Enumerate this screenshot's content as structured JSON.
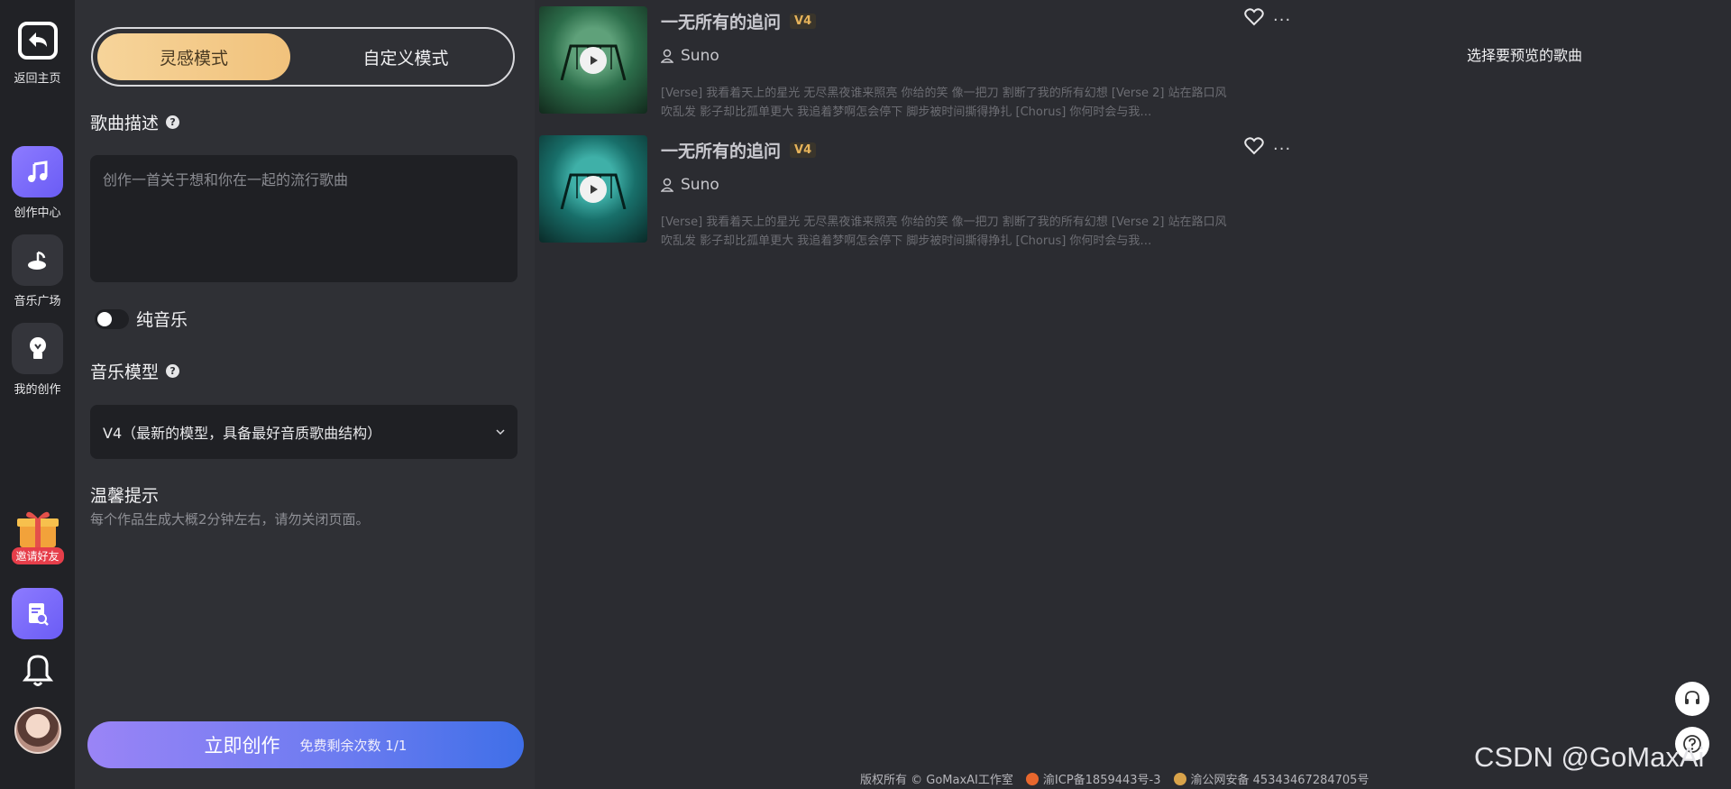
{
  "rail": {
    "back_label": "返回主页",
    "create_label": "创作中心",
    "square_label": "音乐广场",
    "mine_label": "我的创作",
    "invite_label": "邀请好友"
  },
  "panel": {
    "mode_inspire": "灵感模式",
    "mode_custom": "自定义模式",
    "desc_title": "歌曲描述",
    "desc_placeholder": "创作一首关于想和你在一起的流行歌曲",
    "instrumental_label": "纯音乐",
    "model_title": "音乐模型",
    "model_selected": "V4（最新的模型，具备最好音质歌曲结构）",
    "tip_title": "温馨提示",
    "tip_text": "每个作品生成大概2分钟左右，请勿关闭页面。",
    "create_button": "立即创作",
    "free_count": "免费剩余次数 1/1"
  },
  "songs": [
    {
      "title": "一无所有的追问",
      "version": "V4",
      "artist": "Suno",
      "lyrics": "[Verse] 我看着天上的星光 无尽黑夜谁来照亮 你给的笑 像一把刀 割断了我的所有幻想 [Verse 2] 站在路口风吹乱发 影子却比孤单更大 我追着梦啊怎会停下 脚步被时间撕得挣扎 [Chorus] 你何时会与我…"
    },
    {
      "title": "一无所有的追问",
      "version": "V4",
      "artist": "Suno",
      "lyrics": "[Verse] 我看着天上的星光 无尽黑夜谁来照亮 你给的笑 像一把刀 割断了我的所有幻想 [Verse 2] 站在路口风吹乱发 影子却比孤单更大 我追着梦啊怎会停下 脚步被时间撕得挣扎 [Chorus] 你何时会与我…"
    }
  ],
  "preview_hint": "选择要预览的歌曲",
  "footer": {
    "copyright": "版权所有 © GoMaxAI工作室",
    "icp": "渝ICP备1859443号-3",
    "police": "渝公网安备 45343467284705号"
  },
  "watermark": "CSDN @GoMaxAi",
  "colors": {
    "accent_gold": "#f1c27c",
    "accent_purple": "#8d7bff",
    "create_gradient_end": "#3f6fe8"
  }
}
